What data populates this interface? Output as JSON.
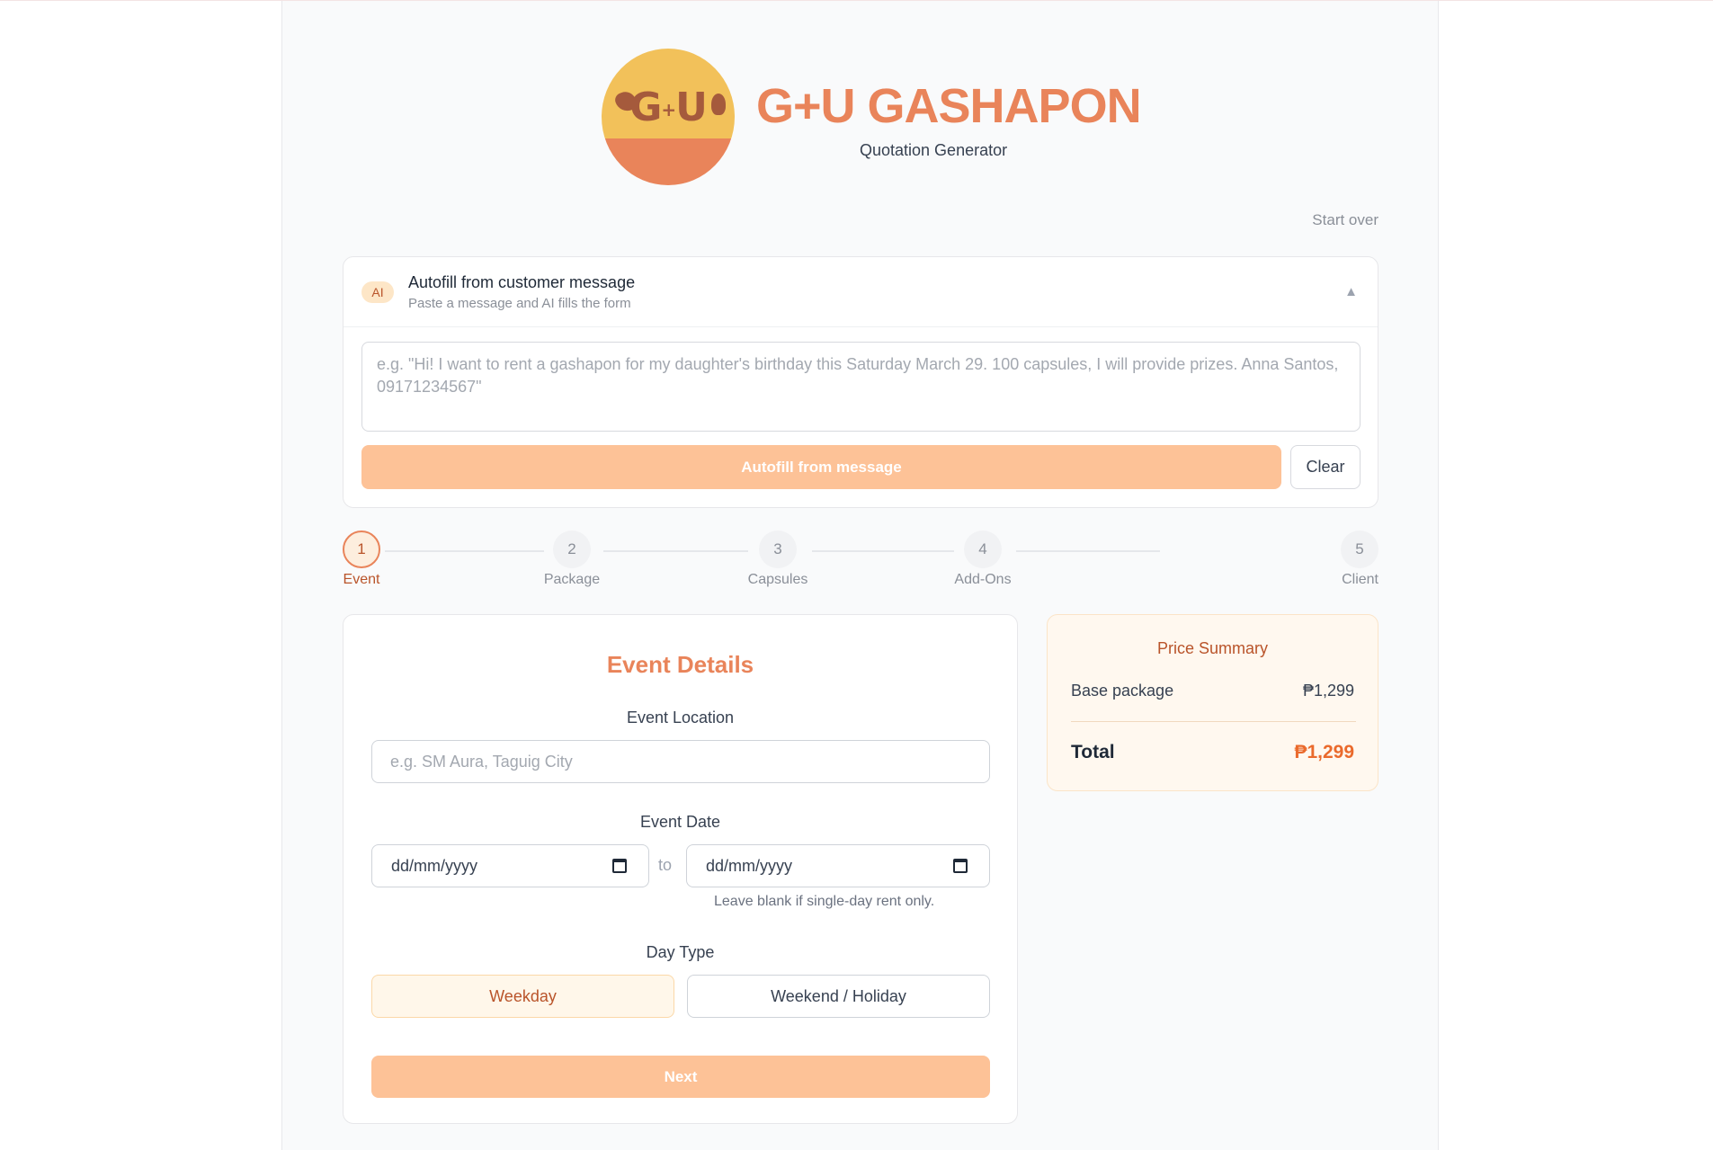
{
  "brand": {
    "logo_text_left": "G",
    "logo_text_plus": "+",
    "logo_text_right": "U",
    "title": "G+U GASHAPON",
    "subtitle": "Quotation Generator"
  },
  "header": {
    "start_over": "Start over"
  },
  "autofill": {
    "badge": "AI",
    "title": "Autofill from customer message",
    "subtitle": "Paste a message and AI fills the form",
    "caret": "▲",
    "placeholder": "e.g. \"Hi! I want to rent a gashapon for my daughter's birthday this Saturday March 29. 100 capsules, I will provide prizes. Anna Santos, 09171234567\"",
    "value": "",
    "autofill_label": "Autofill from message",
    "clear_label": "Clear"
  },
  "stepper": {
    "current": 1,
    "steps": [
      {
        "number": "1",
        "label": "Event"
      },
      {
        "number": "2",
        "label": "Package"
      },
      {
        "number": "3",
        "label": "Capsules"
      },
      {
        "number": "4",
        "label": "Add-Ons"
      },
      {
        "number": "5",
        "label": "Client"
      }
    ]
  },
  "event": {
    "title": "Event Details",
    "location_label": "Event Location",
    "location_placeholder": "e.g. SM Aura, Taguig City",
    "location_value": "",
    "date_label": "Event Date",
    "date_start_placeholder": "dd/mm/yyyy",
    "date_end_placeholder": "dd/mm/yyyy",
    "date_to": "to",
    "date_help": "Leave blank if single-day rent only.",
    "daytype_label": "Day Type",
    "daytype_options": [
      "Weekday",
      "Weekend / Holiday"
    ],
    "daytype_selected": "Weekday",
    "next_label": "Next"
  },
  "summary": {
    "title": "Price Summary",
    "base_label": "Base package",
    "base_value": "₱1,299",
    "total_label": "Total",
    "total_value": "₱1,299"
  },
  "colors": {
    "accent": "#e9845a",
    "accent_dark": "#b9542a",
    "button_disabled": "#fdc297",
    "total": "#ea6a2c",
    "logo_yellow": "#f2c15a"
  },
  "icons": {
    "calendar": "calendar-icon",
    "collapse": "chevron-up-icon"
  }
}
